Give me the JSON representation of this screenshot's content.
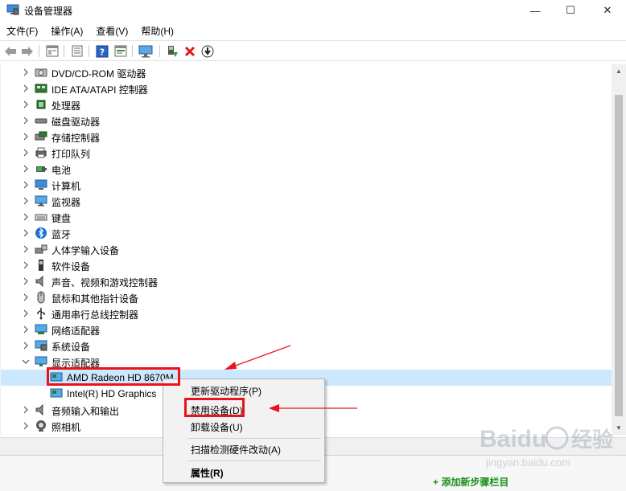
{
  "window": {
    "title": "设备管理器",
    "minimize": "—",
    "maximize": "☐",
    "close": "✕"
  },
  "menu": [
    "文件(F)",
    "操作(A)",
    "查看(V)",
    "帮助(H)"
  ],
  "tree": {
    "categories": [
      {
        "label": "DVD/CD-ROM 驱动器",
        "icon": "dvd-drive-icon",
        "expanded": false
      },
      {
        "label": "IDE ATA/ATAPI 控制器",
        "icon": "ide-controller-icon",
        "expanded": false
      },
      {
        "label": "处理器",
        "icon": "processor-icon",
        "expanded": false
      },
      {
        "label": "磁盘驱动器",
        "icon": "disk-drive-icon",
        "expanded": false
      },
      {
        "label": "存储控制器",
        "icon": "storage-controller-icon",
        "expanded": false
      },
      {
        "label": "打印队列",
        "icon": "printer-icon",
        "expanded": false
      },
      {
        "label": "电池",
        "icon": "battery-icon",
        "expanded": false
      },
      {
        "label": "计算机",
        "icon": "computer-icon",
        "expanded": false
      },
      {
        "label": "监视器",
        "icon": "monitor-icon",
        "expanded": false
      },
      {
        "label": "键盘",
        "icon": "keyboard-icon",
        "expanded": false
      },
      {
        "label": "蓝牙",
        "icon": "bluetooth-icon",
        "expanded": false
      },
      {
        "label": "人体学输入设备",
        "icon": "hid-icon",
        "expanded": false
      },
      {
        "label": "软件设备",
        "icon": "software-device-icon",
        "expanded": false
      },
      {
        "label": "声音、视频和游戏控制器",
        "icon": "sound-icon",
        "expanded": false
      },
      {
        "label": "鼠标和其他指针设备",
        "icon": "mouse-icon",
        "expanded": false
      },
      {
        "label": "通用串行总线控制器",
        "icon": "usb-icon",
        "expanded": false
      },
      {
        "label": "网络适配器",
        "icon": "network-adapter-icon",
        "expanded": false
      },
      {
        "label": "系统设备",
        "icon": "system-device-icon",
        "expanded": false
      },
      {
        "label": "显示适配器",
        "icon": "display-adapter-icon",
        "expanded": true
      },
      {
        "label": "音频输入和输出",
        "icon": "audio-io-icon",
        "expanded": false
      },
      {
        "label": "照相机",
        "icon": "camera-icon",
        "expanded": false
      }
    ],
    "display_children": [
      {
        "label": "AMD Radeon HD 8670M",
        "icon": "display-card-icon",
        "selected": true
      },
      {
        "label": "Intel(R) HD Graphics",
        "icon": "display-card-icon",
        "selected": false
      }
    ]
  },
  "context_menu": {
    "update_driver": "更新驱动程序(P)",
    "disable_device": "禁用设备(D)",
    "uninstall_device": "卸载设备(U)",
    "scan_hardware": "扫描检测硬件改动(A)",
    "properties": "属性(R)"
  },
  "footer": {
    "add_step": "+ 添加新步骤栏目"
  },
  "watermark": {
    "brand": "Baidu",
    "brand_cn": "经验",
    "url": "jingyan.baidu.com"
  },
  "colors": {
    "annotation_red": "#e8141c",
    "selection_blue": "#cce8ff"
  }
}
